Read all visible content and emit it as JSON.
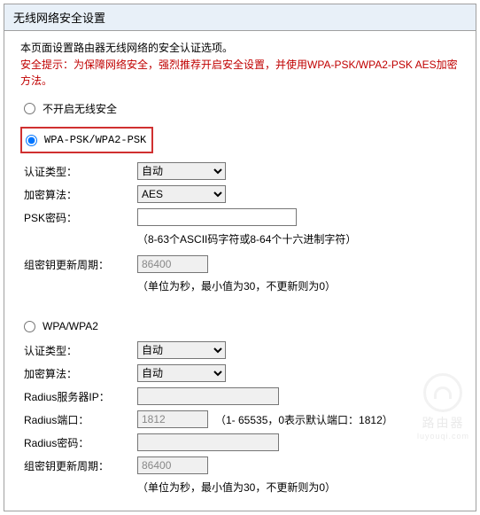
{
  "panel": {
    "title": "无线网络安全设置"
  },
  "intro": "本页面设置路由器无线网络的安全认证选项。",
  "warning": "安全提示：为保障网络安全，强烈推荐开启安全设置，并使用WPA-PSK/WPA2-PSK AES加密方法。",
  "options": {
    "none": {
      "label": "不开启无线安全",
      "checked": false
    },
    "wpapsk": {
      "label": "WPA-PSK/WPA2-PSK",
      "checked": true
    },
    "wpa": {
      "label": "WPA/WPA2",
      "checked": false
    }
  },
  "wpapsk": {
    "auth_label": "认证类型：",
    "auth_value": "自动",
    "encrypt_label": "加密算法：",
    "encrypt_value": "AES",
    "psk_label": "PSK密码：",
    "psk_value": "",
    "psk_hint": "（8-63个ASCII码字符或8-64个十六进制字符）",
    "rekey_label": "组密钥更新周期：",
    "rekey_value": "86400",
    "rekey_hint": "（单位为秒，最小值为30，不更新则为0）"
  },
  "wpa": {
    "auth_label": "认证类型：",
    "auth_value": "自动",
    "encrypt_label": "加密算法：",
    "encrypt_value": "自动",
    "radius_ip_label": "Radius服务器IP：",
    "radius_ip_value": "",
    "radius_port_label": "Radius端口：",
    "radius_port_value": "1812",
    "radius_port_hint": "（1- 65535，0表示默认端口：1812）",
    "radius_pwd_label": "Radius密码：",
    "radius_pwd_value": "",
    "rekey_label": "组密钥更新周期：",
    "rekey_value": "86400",
    "rekey_hint": "（单位为秒，最小值为30，不更新则为0）"
  },
  "watermark": {
    "main": "路由器",
    "sub": "luyouqi.com"
  }
}
